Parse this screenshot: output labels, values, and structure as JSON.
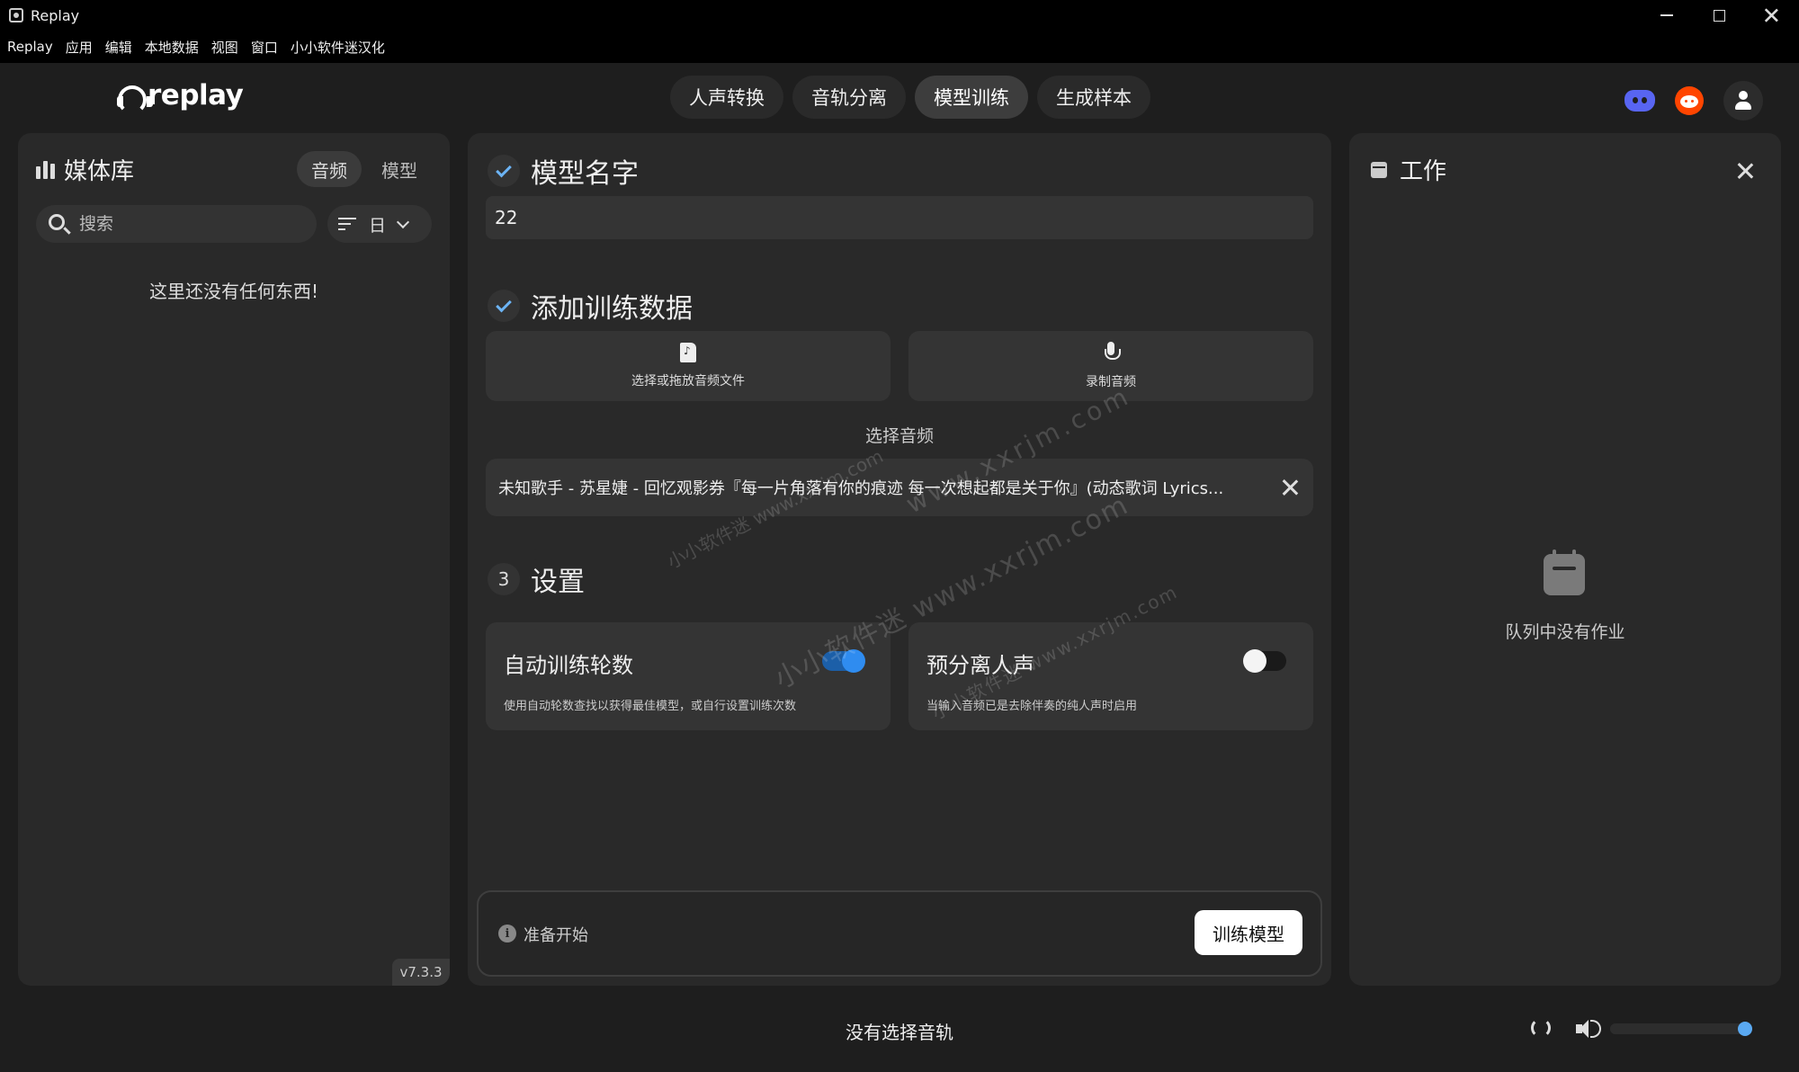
{
  "window": {
    "title": "Replay"
  },
  "menu": [
    "Replay",
    "应用",
    "编辑",
    "本地数据",
    "视图",
    "窗口",
    "小小软件迷汉化"
  ],
  "header": {
    "logo_text": "replay",
    "tabs": [
      {
        "label": "人声转换",
        "active": false
      },
      {
        "label": "音轨分离",
        "active": false
      },
      {
        "label": "模型训练",
        "active": true
      },
      {
        "label": "生成样本",
        "active": false
      }
    ],
    "icons": [
      "discord-icon",
      "reddit-icon",
      "user-icon"
    ]
  },
  "library": {
    "title": "媒体库",
    "tabs": [
      {
        "label": "音频",
        "active": true
      },
      {
        "label": "模型",
        "active": false
      }
    ],
    "search_placeholder": "搜索",
    "sort_label": "日",
    "empty_text": "这里还没有任何东西!",
    "version": "v7.3.3"
  },
  "training": {
    "step1": {
      "title": "模型名字",
      "value": "22"
    },
    "step2": {
      "title": "添加训练数据",
      "upload_label": "选择或拖放音频文件",
      "record_label": "录制音频",
      "selected_heading": "选择音频",
      "selected_file": "未知歌手 - 苏星婕 - 回忆观影券『每一片角落有你的痕迹 每一次想起都是关于你』(动态歌词 Lyrics..."
    },
    "step3": {
      "number": "3",
      "title": "设置",
      "auto_epochs": {
        "title": "自动训练轮数",
        "desc": "使用自动轮数查找以获得最佳模型，或自行设置训练次数",
        "enabled": true
      },
      "pre_separate": {
        "title": "预分离人声",
        "desc": "当输入音频已是去除伴奏的纯人声时启用",
        "enabled": false
      }
    },
    "status_text": "准备开始",
    "train_button": "训练模型"
  },
  "work": {
    "title": "工作",
    "empty_text": "队列中没有作业"
  },
  "player": {
    "track_text": "没有选择音轨",
    "volume": 1.0
  },
  "watermark": {
    "lines": [
      "小小软件迷 www.xxrjm.com",
      "www.xxrjm.com",
      "小小软件迷 www.xxrjm.com",
      "小小软件迷 www.xxrjm.com"
    ]
  },
  "colors": {
    "accent": "#2f8cf0",
    "panel": "#292929",
    "background": "#1e1e1e"
  }
}
